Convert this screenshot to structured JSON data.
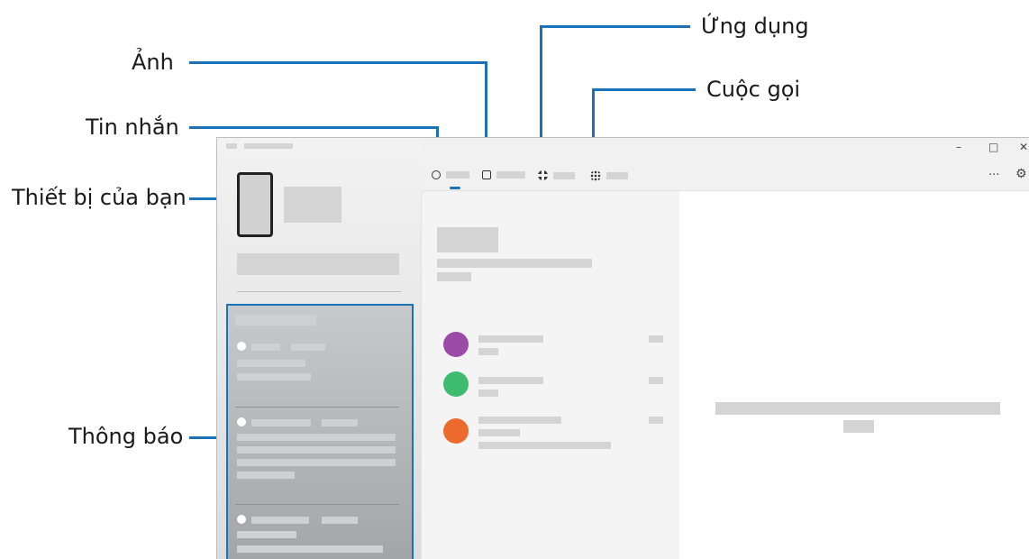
{
  "callouts": {
    "apps": "Ứng dụng",
    "photos": "Ảnh",
    "calls": "Cuộc gọi",
    "messages": "Tin nhắn",
    "your_device": "Thiết bị của bạn",
    "notifications": "Thông báo"
  },
  "window_controls": {
    "minimize": "–",
    "maximize": "□",
    "close": "✕"
  },
  "header_actions": {
    "more": "···",
    "settings": "⚙"
  },
  "icons": {
    "messages_tab": "chat-bubble-icon",
    "photos_tab": "image-icon",
    "apps_tab": "grid-apps-icon",
    "calls_tab": "dialpad-icon"
  },
  "colors": {
    "callout_line": "#1a73b8",
    "avatar_1": "#9b4aa8",
    "avatar_2": "#3dbb6e",
    "avatar_3": "#ec6a2c"
  }
}
